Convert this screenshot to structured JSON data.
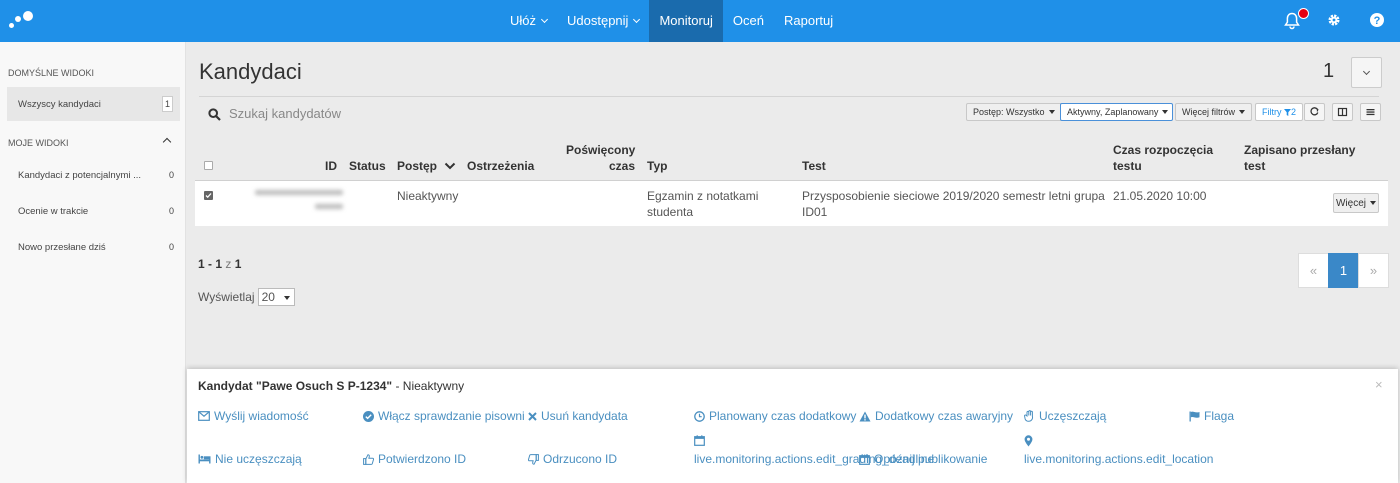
{
  "nav": {
    "items": [
      {
        "label": "Ułóż",
        "dropdown": true
      },
      {
        "label": "Udostępnij",
        "dropdown": true
      },
      {
        "label": "Monitoruj",
        "active": true
      },
      {
        "label": "Oceń"
      },
      {
        "label": "Raportuj"
      }
    ],
    "icons": [
      "bell-icon",
      "gear-icon",
      "help-icon"
    ]
  },
  "sidebar": {
    "default_views_title": "DOMYŚLNE WIDOKI",
    "default_views": [
      {
        "label": "Wszyscy kandydaci",
        "count": "1"
      }
    ],
    "my_views_title": "MOJE WIDOKI",
    "my_views": [
      {
        "label": "Kandydaci z potencjalnymi ...",
        "count": "0"
      },
      {
        "label": "Ocenie w trakcie",
        "count": "0"
      },
      {
        "label": "Nowo przesłane dziś",
        "count": "0"
      }
    ]
  },
  "main": {
    "title": "Kandydaci",
    "count": "1",
    "search_placeholder": "Szukaj kandydatów",
    "filters": {
      "progress": "Postęp: Wszystko",
      "status": "Aktywny, Zaplanowany",
      "more_filters": "Więcej filtrów",
      "filters_label": "Filtry",
      "filters_count": "2"
    },
    "table": {
      "headers": {
        "id": "ID",
        "status": "Status",
        "progress": "Postęp",
        "warnings": "Ostrzeżenia",
        "time_spent_1": "Poświęcony",
        "time_spent_2": "czas",
        "type": "Typ",
        "test": "Test",
        "start_1": "Czas rozpoczęcia",
        "start_2": "testu",
        "saved_1": "Zapisano przesłany",
        "saved_2": "test"
      },
      "rows": [
        {
          "progress": "Nieaktywny",
          "type_1": "Egzamin z notatkami",
          "type_2": "studenta",
          "test_1": "Przysposobienie sieciowe 2019/2020 semestr letni grupa",
          "test_2": "ID01",
          "start": "21.05.2020 10:00",
          "more": "Więcej"
        }
      ]
    },
    "pagination": {
      "range": "1 - 1",
      "of": "z",
      "total": "1",
      "per_page_label": "Wyświetlaj",
      "per_page": "20",
      "prev": "«",
      "current": "1",
      "next": "»"
    }
  },
  "panel": {
    "title": "Kandydat \"Pawe Osuch S P-1234\"",
    "status": " - Nieaktywny",
    "close": "×",
    "actions": {
      "send_message": "Wyślij wiadomość",
      "spellcheck": "Włącz sprawdzanie pisowni",
      "remove": "Usuń kandydata",
      "scheduled_extra": "Planowany czas dodatkowy",
      "emergency_extra": "Dodatkowy czas awaryjny",
      "attend": "Uczęszczają",
      "flag": "Flaga",
      "not_attend": "Nie uczęszczają",
      "id_confirmed": "Potwierdzono ID",
      "id_rejected": "Odrzucono ID",
      "edit_grading": "live.monitoring.actions.edit_grading_deadline",
      "delay_publish": "Opóźnij publikowanie",
      "edit_location": "live.monitoring.actions.edit_location"
    }
  },
  "colors": {
    "topbar": "#1f90e8",
    "nav_active": "#1a6bad",
    "link": "#4a8fc0",
    "badge": "#e60012"
  }
}
